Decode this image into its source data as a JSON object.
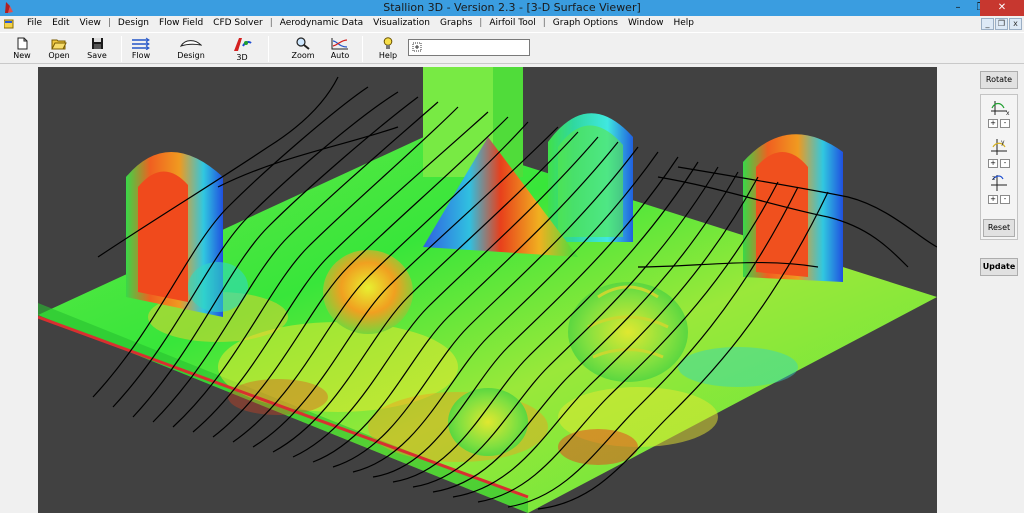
{
  "window": {
    "title": "Stallion 3D - Version 2.3 - [3-D Surface Viewer]",
    "min_glyph": "–",
    "max_glyph": "❐",
    "close_glyph": "✕"
  },
  "menu": {
    "items": [
      "File",
      "Edit",
      "View",
      "|",
      "Design",
      "Flow Field",
      "CFD Solver",
      "|",
      "Aerodynamic Data",
      "Visualization",
      "Graphs",
      "|",
      "Airfoil Tool",
      "|",
      "Graph Options",
      "Window",
      "Help"
    ],
    "mdi_min": "_",
    "mdi_restore": "❐",
    "mdi_close": "x"
  },
  "toolbar": {
    "new": "New",
    "open": "Open",
    "save": "Save",
    "flow": "Flow",
    "design": "Design",
    "view3d": "3D",
    "zoom": "Zoom",
    "auto": "Auto",
    "help": "Help",
    "coord_value": ""
  },
  "right_panel": {
    "rotate": "Rotate",
    "reset": "Reset",
    "update": "Update",
    "plus": "+",
    "minus": "-",
    "axes": [
      "x-axis-rotation",
      "y-axis-rotation",
      "z-axis-rotation"
    ]
  },
  "colors": {
    "title_bar": "#3a9de0",
    "close_red": "#c7372f",
    "viewport_bg": "#414141",
    "surface_green": "#3ee83e",
    "surface_yellow": "#e0ea30",
    "surface_red": "#e8401c",
    "surface_blue": "#2060e8",
    "streamline": "#000000",
    "edge_red": "#d83030"
  },
  "viewport": {
    "content": "3-D surface pressure contour of a graveyard scene with tombstones, pumpkins and flow streamlines"
  }
}
